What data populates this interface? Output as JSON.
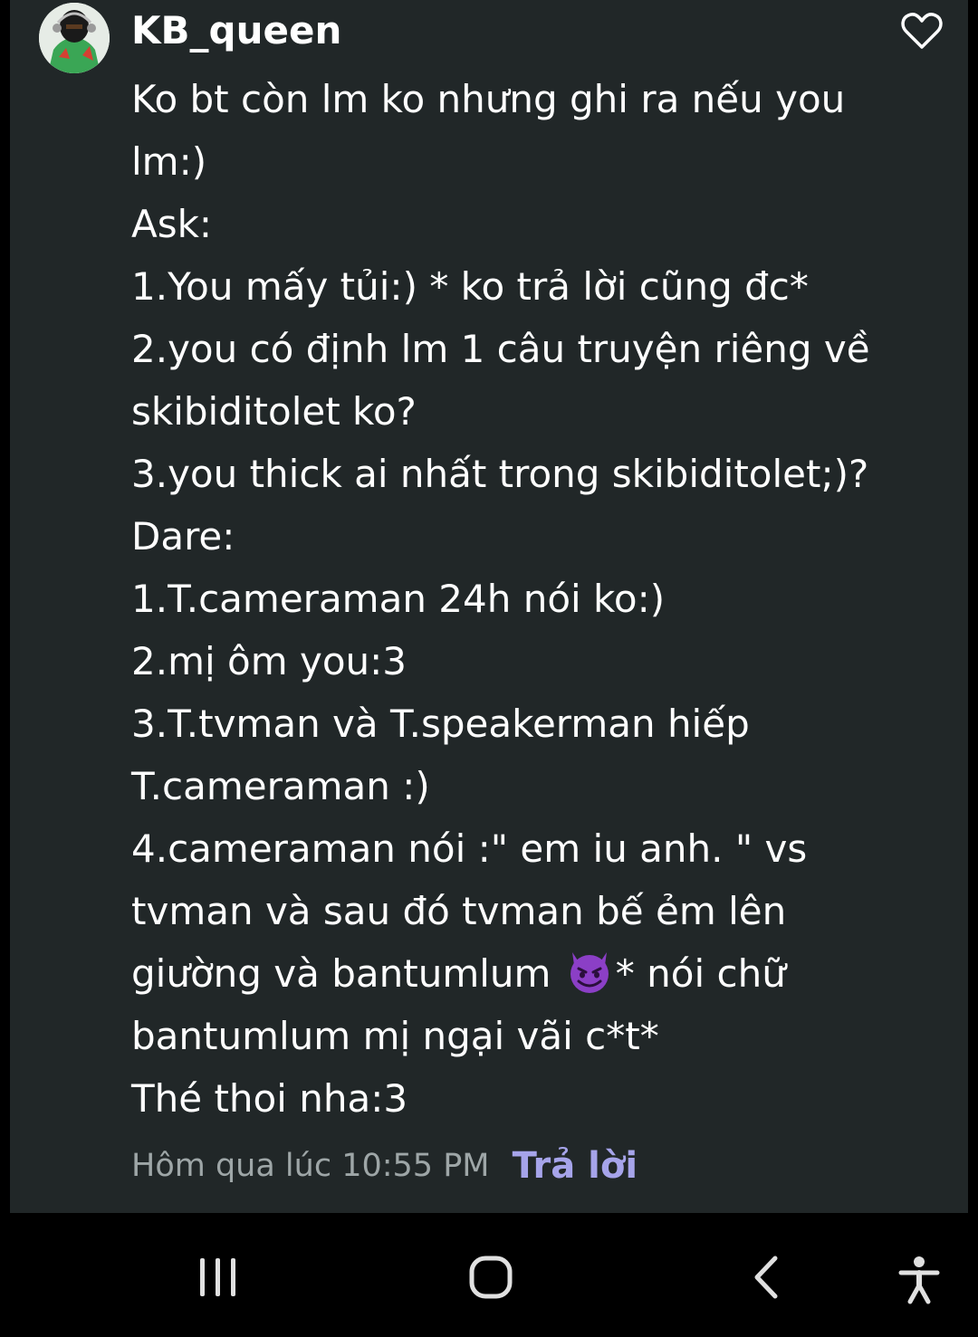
{
  "comment": {
    "username": "KB_queen",
    "body_lines": [
      "Ko bt còn lm ko nhưng ghi ra nếu you",
      "lm:)",
      "Ask:",
      "1.You mấy tủi:) * ko trả lời cũng đc*",
      "2.you có định lm 1 câu truyện riêng về",
      "skibiditolet ko?",
      "3.you thick ai nhất trong skibiditolet;)?",
      "Dare:",
      "1.T.cameraman 24h nói ko:)",
      "2.mị ôm you:3",
      "3.T.tvman và T.speakerman hiếp",
      "T.cameraman :)",
      "4.cameraman nói :\" em iu anh. \" vs",
      "tvman và sau đó tvman bế ẻm lên",
      "bantumlum mị ngại vãi c*t*",
      "Thé thoi nha:3"
    ],
    "emoji_line": {
      "before": "giường và bantumlum ",
      "emoji": "smiling-devil-emoji",
      "after": "* nói chữ"
    },
    "timestamp": "Hôm qua lúc 10:55 PM",
    "reply_label": "Trả lời",
    "like_icon": "heart-outline-icon"
  },
  "navigation_bar": {
    "buttons": [
      {
        "name": "recent-apps",
        "icon": "recent-apps-icon"
      },
      {
        "name": "home",
        "icon": "home-icon"
      },
      {
        "name": "back",
        "icon": "back-chevron-icon"
      },
      {
        "name": "accessibility",
        "icon": "accessibility-icon"
      }
    ]
  },
  "colors": {
    "card_background": "#212728",
    "text": "#ffffff",
    "timestamp": "#9ea6a7",
    "reply_accent": "#a6a4ea",
    "nav_background": "#000000"
  }
}
